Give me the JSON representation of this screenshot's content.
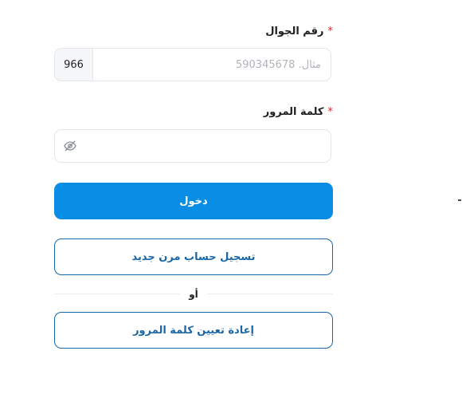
{
  "form": {
    "phone": {
      "label": "رقم الجوال",
      "required_mark": "*",
      "country_code": "966",
      "placeholder": "مثال. 590345678",
      "value": ""
    },
    "password": {
      "label": "كلمة المرور",
      "required_mark": "*",
      "value": "",
      "toggle_icon": "eye-off-icon"
    },
    "login_label": "دخول",
    "register_label": "تسجيل حساب مرن جديد",
    "or_label": "أو",
    "reset_label": "إعادة تعيين كلمة المرور"
  },
  "colors": {
    "primary": "#0a8ee5",
    "outline": "#1b67a6",
    "required": "#d9262c"
  }
}
